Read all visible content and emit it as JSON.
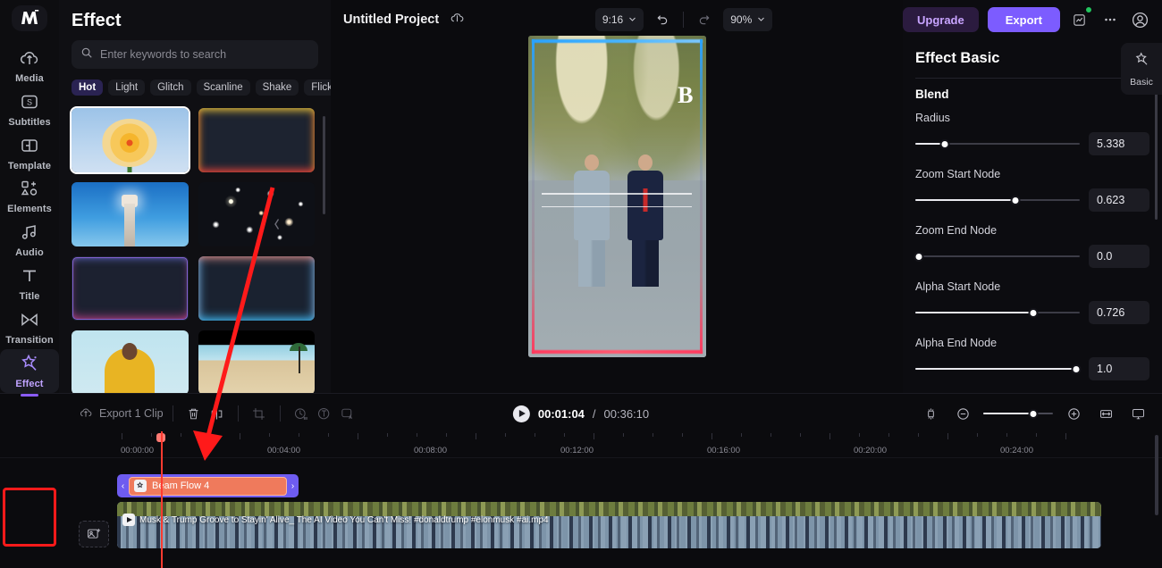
{
  "app": {
    "logo": "M",
    "rail": [
      {
        "label": "Media",
        "icon": "cloud-upload-icon",
        "active": false
      },
      {
        "label": "Subtitles",
        "icon": "subtitles-icon",
        "active": false
      },
      {
        "label": "Template",
        "icon": "template-icon",
        "active": false
      },
      {
        "label": "Elements",
        "icon": "elements-icon",
        "active": false
      },
      {
        "label": "Audio",
        "icon": "audio-note-icon",
        "active": false
      },
      {
        "label": "Title",
        "icon": "title-text-icon",
        "active": false
      },
      {
        "label": "Transition",
        "icon": "transition-icon",
        "active": false
      },
      {
        "label": "Effect",
        "icon": "effect-magic-wand-icon",
        "active": true
      }
    ]
  },
  "panel": {
    "title": "Effect",
    "search_placeholder": "Enter keywords to search",
    "search_value": "",
    "search_icon": "search-icon",
    "tags": [
      "Hot",
      "Light",
      "Glitch",
      "Scanline",
      "Shake",
      "Flicker"
    ],
    "selected_tag": "Hot",
    "thumbnails": [
      {
        "name": "flower-effect-thumbnail",
        "style": "t-flower",
        "selected": true
      },
      {
        "name": "warm-border-effect-thumbnail",
        "style": "t-warm",
        "selected": false
      },
      {
        "name": "lighthouse-effect-thumbnail",
        "style": "t-light",
        "selected": false
      },
      {
        "name": "stars-effect-thumbnail",
        "style": "t-stars",
        "selected": false
      },
      {
        "name": "purple-border-effect-thumbnail",
        "style": "t-purple",
        "selected": false
      },
      {
        "name": "blue-border-effect-thumbnail",
        "style": "t-blue",
        "selected": false
      },
      {
        "name": "yellow-outfit-effect-thumbnail",
        "style": "t-yellow",
        "selected": false
      },
      {
        "name": "beach-effect-thumbnail",
        "style": "t-beach",
        "selected": false
      }
    ],
    "collapse_icon": "chevron-left-icon"
  },
  "topbar": {
    "project_name": "Untitled Project",
    "cloud_icon": "cloud-sync-icon",
    "aspect_ratio": "9:16",
    "undo_icon": "undo-icon",
    "redo_icon": "redo-icon",
    "zoom_level": "90%",
    "upgrade_label": "Upgrade",
    "export_label": "Export",
    "notification_icon": "feedback-icon",
    "more_icon": "more-options-icon",
    "account_icon": "account-avatar-icon"
  },
  "preview": {
    "watermark": "B"
  },
  "props": {
    "title": "Effect Basic",
    "close_icon": "close-icon",
    "section": "Blend",
    "controls": [
      {
        "label": "Radius",
        "value": "5.338",
        "percent": 18
      },
      {
        "label": "Zoom Start Node",
        "value": "0.623",
        "percent": 61
      },
      {
        "label": "Zoom End Node",
        "value": "0.0",
        "percent": 0
      },
      {
        "label": "Alpha Start Node",
        "value": "0.726",
        "percent": 72
      },
      {
        "label": "Alpha End Node",
        "value": "1.0",
        "percent": 100
      }
    ],
    "side_tab": {
      "label": "Basic",
      "icon": "effect-magic-wand-icon"
    }
  },
  "timeline": {
    "export_clip_label": "Export 1 Clip",
    "export_icon": "cloud-export-icon",
    "tools": [
      {
        "name": "delete-icon",
        "dim": false
      },
      {
        "name": "split-icon",
        "dim": false
      },
      {
        "name": "crop-icon",
        "dim": true
      },
      {
        "name": "speed-ramp-icon",
        "dim": true
      },
      {
        "name": "auto-reframe-icon",
        "dim": true
      },
      {
        "name": "auto-caption-icon",
        "dim": true
      }
    ],
    "current_time": "00:01:04",
    "total_time": "00:36:10",
    "time_separator": "/",
    "play_icon": "play-icon",
    "right_tools": [
      {
        "name": "snap-magnet-icon"
      },
      {
        "name": "zoom-out-icon"
      },
      {
        "name": "zoom-in-icon"
      },
      {
        "name": "fit-timeline-icon"
      },
      {
        "name": "preview-render-icon"
      }
    ],
    "zoom_percent": 72,
    "ruler_labels": [
      "00:00:00",
      "00:04:00",
      "00:08:00",
      "00:12:00",
      "00:16:00",
      "00:20:00",
      "00:24:00"
    ],
    "effect_clip": {
      "name": "Beam Flow 4",
      "icon": "effect-magic-wand-icon",
      "left_handle": "‹",
      "right_handle": "›"
    },
    "video_clip": {
      "name": "Musk & Trump Groove to Stayin' Alive_ The AI Video You Can't Miss! #donaldtrump #elonmusk #ai.mp4",
      "play_icon": "play-icon"
    },
    "track_icon": "add-media-icon"
  },
  "colors": {
    "accent": "#7c5cff",
    "upgrade": "#c8a4ff",
    "playhead": "#ff3b30",
    "effect_clip": "#6e5cf0",
    "effect_inner": "#ef7a5c",
    "annotation": "#ff1a1a"
  }
}
